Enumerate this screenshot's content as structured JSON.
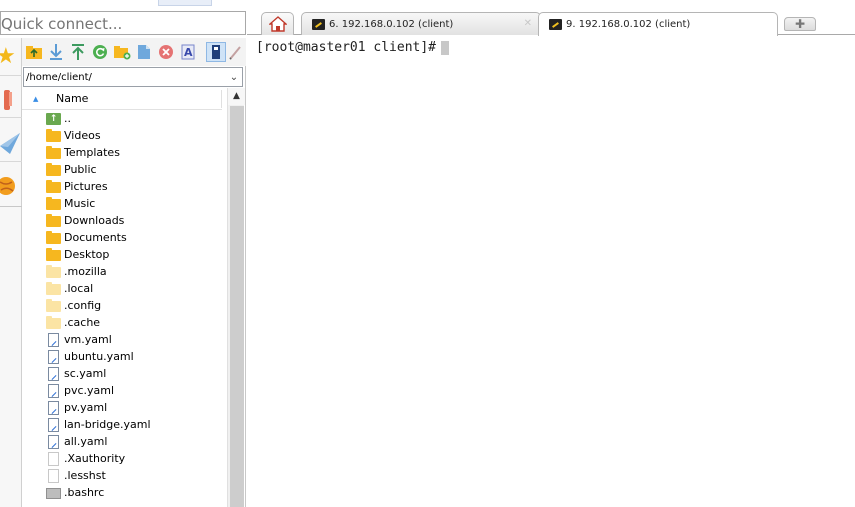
{
  "quick_connect": {
    "placeholder": "Quick connect..."
  },
  "sftp": {
    "path": "/home/client/",
    "column_header": "Name",
    "files": [
      {
        "name": "..",
        "kind": "parent"
      },
      {
        "name": "Videos",
        "kind": "folder"
      },
      {
        "name": "Templates",
        "kind": "folder"
      },
      {
        "name": "Public",
        "kind": "folder"
      },
      {
        "name": "Pictures",
        "kind": "folder"
      },
      {
        "name": "Music",
        "kind": "folder"
      },
      {
        "name": "Downloads",
        "kind": "folder"
      },
      {
        "name": "Documents",
        "kind": "folder"
      },
      {
        "name": "Desktop",
        "kind": "folder"
      },
      {
        "name": ".mozilla",
        "kind": "hidden-folder"
      },
      {
        "name": ".local",
        "kind": "hidden-folder"
      },
      {
        "name": ".config",
        "kind": "hidden-folder"
      },
      {
        "name": ".cache",
        "kind": "hidden-folder"
      },
      {
        "name": "vm.yaml",
        "kind": "yaml"
      },
      {
        "name": "ubuntu.yaml",
        "kind": "yaml"
      },
      {
        "name": "sc.yaml",
        "kind": "yaml"
      },
      {
        "name": "pvc.yaml",
        "kind": "yaml"
      },
      {
        "name": "pv.yaml",
        "kind": "yaml"
      },
      {
        "name": "lan-bridge.yaml",
        "kind": "yaml"
      },
      {
        "name": "all.yaml",
        "kind": "yaml"
      },
      {
        "name": ".Xauthority",
        "kind": "plain"
      },
      {
        "name": ".lesshst",
        "kind": "plain"
      },
      {
        "name": ".bashrc",
        "kind": "gray"
      }
    ]
  },
  "tabs": [
    {
      "label": "6. 192.168.0.102 (client)",
      "active": false
    },
    {
      "label": "9. 192.168.0.102 (client)",
      "active": true
    }
  ],
  "terminal": {
    "prompt": "[root@master01 client]#"
  },
  "icons": {
    "dock": [
      "star-icon",
      "tools-icon",
      "paper-plane-icon",
      "globe-icon"
    ],
    "toolbar": [
      "upload-folder-icon",
      "download-icon",
      "upload-icon",
      "refresh-icon",
      "new-folder-icon",
      "new-file-icon",
      "delete-icon",
      "text-mode-icon",
      "binary-mode-icon",
      "edit-icon"
    ]
  },
  "colors": {
    "folder": "#f6b71f",
    "selection": "#cfe3f7",
    "accent": "#3a8ee6"
  }
}
